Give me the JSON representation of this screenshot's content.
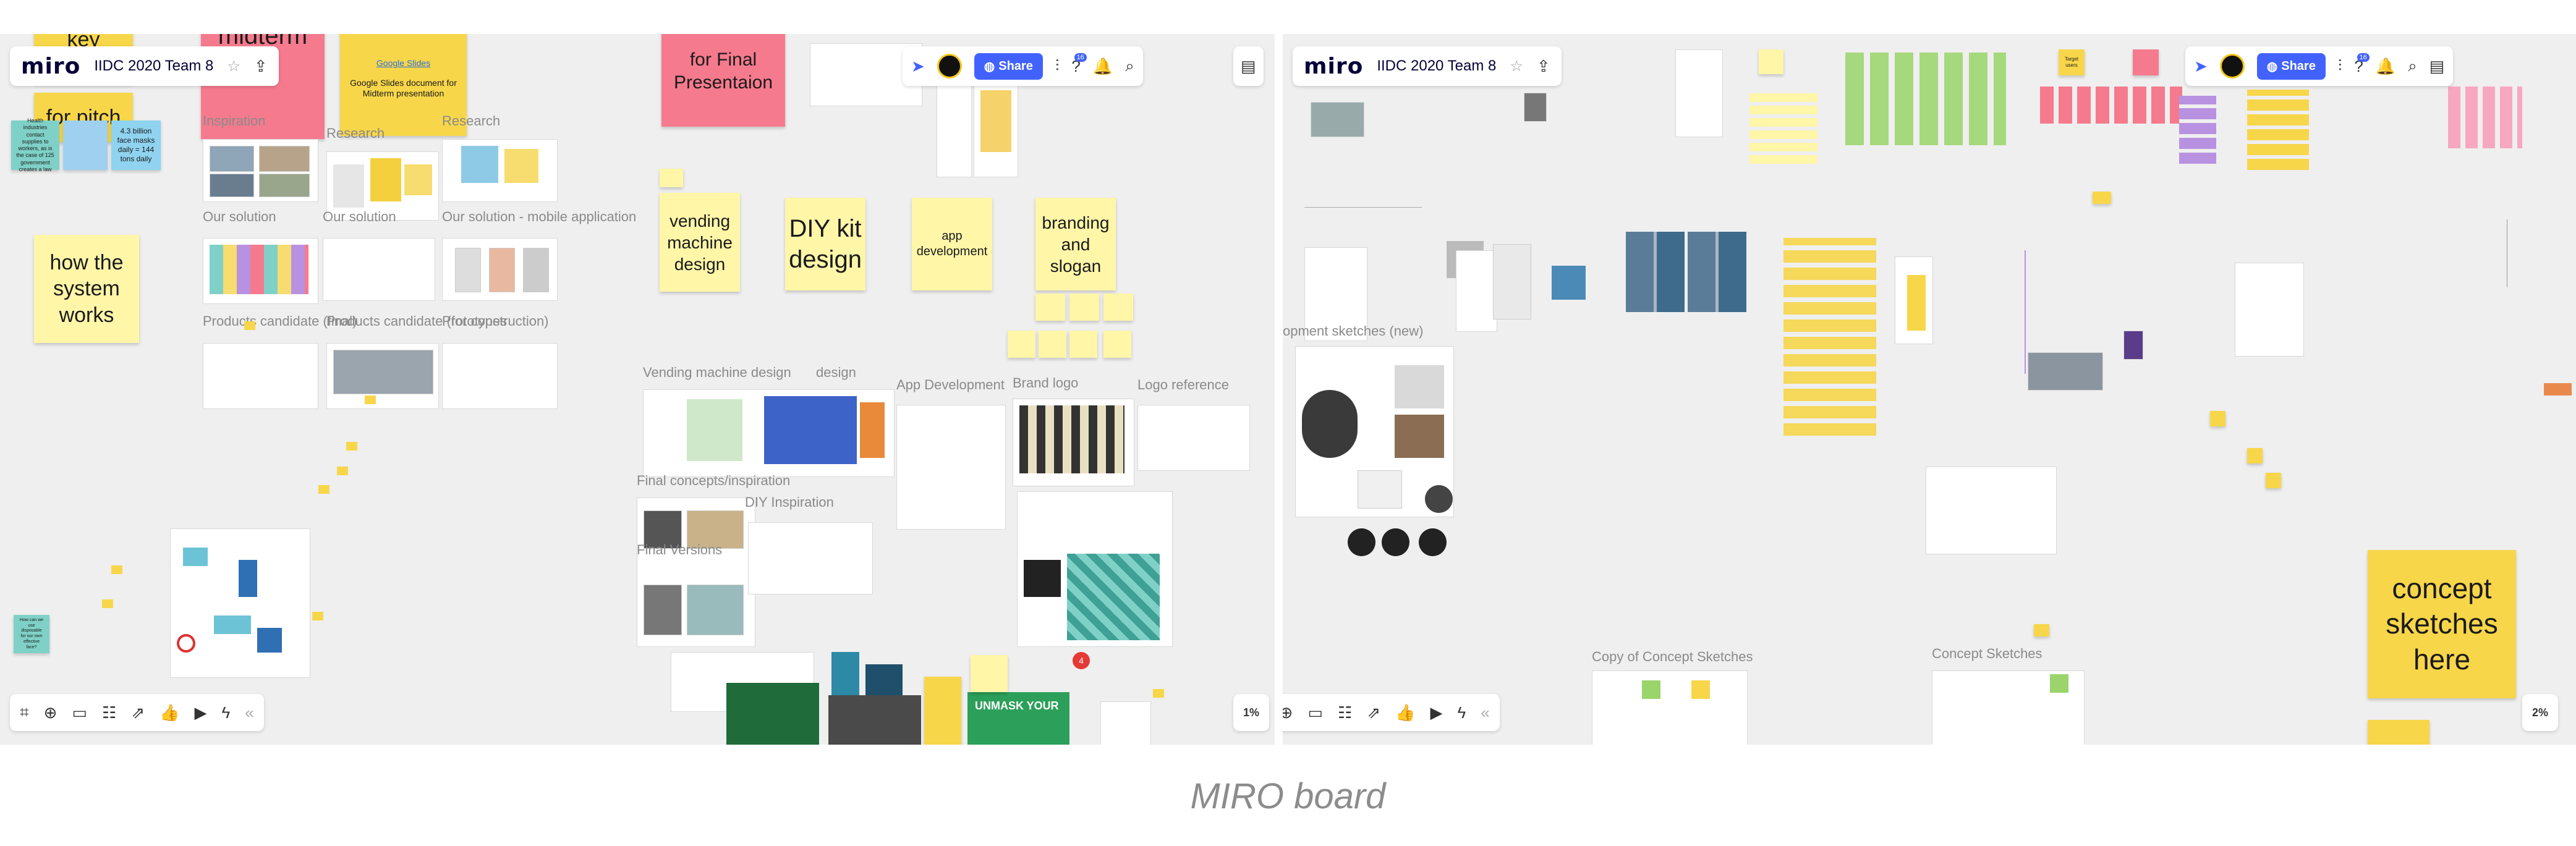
{
  "left": {
    "logo": "miro",
    "board_title": "IIDC 2020 Team 8",
    "share_label": "Share",
    "notif_count": "16",
    "zoom": "1%",
    "stickies": {
      "pitch": "for pitch",
      "key": "key",
      "midterm": "midterm",
      "slides_doc": "Google Slides document for Midterm presentation",
      "slides_link": "Google Slides",
      "final": "for Final Presentaion",
      "system": "how the system works",
      "vending": "vending machine design",
      "diy": "DIY kit design",
      "app": "app development",
      "branding": "branding and slogan",
      "billion": "4.3 billion face masks daily = 144 tons daily",
      "industries": "Health industries contact supplies to workers, as is the case of 125 government creates a law",
      "blue_small": "How can we use disposable for our own effective face?"
    },
    "frames": {
      "inspiration": "Inspiration",
      "research1": "Research",
      "research2": "Research",
      "our_solution": "Our solution",
      "our_solution2": "Our solution",
      "our_solution_mobile": "Our solution - mobile application",
      "products_candidate": "Products candidate (final)",
      "products_construction": "Products candidate (for construction)",
      "prototypes": "Prototypes",
      "vending_design": "Vending machine design",
      "vending_design_tail": "design",
      "app_dev": "App Development",
      "brand_logo": "Brand logo",
      "logo_ref": "Logo reference",
      "final_concepts": "Final concepts/inspiration",
      "diy_inspiration": "DIY Inspiration",
      "final_versions": "Final Versions"
    },
    "poster": "UNMASK YOUR",
    "red_badge": "4"
  },
  "right": {
    "logo": "miro",
    "board_title": "IIDC 2020 Team 8",
    "share_label": "Share",
    "notif_count": "16",
    "zoom": "2%",
    "concept_sticky": "concept sketches here",
    "frames": {
      "dev_sketches": "opment sketches (new)",
      "copy_concept": "Copy of Concept Sketches",
      "concept": "Concept Sketches"
    },
    "top_stickies": {
      "s1": "Target users"
    }
  },
  "caption": "MIRO board",
  "colors": {
    "canvas": "#efefef",
    "accent": "#4262ff",
    "sticky_yellow": "#fff6a8",
    "sticky_dark_yellow": "#f7d64a",
    "sticky_pink": "#f57a8d"
  }
}
